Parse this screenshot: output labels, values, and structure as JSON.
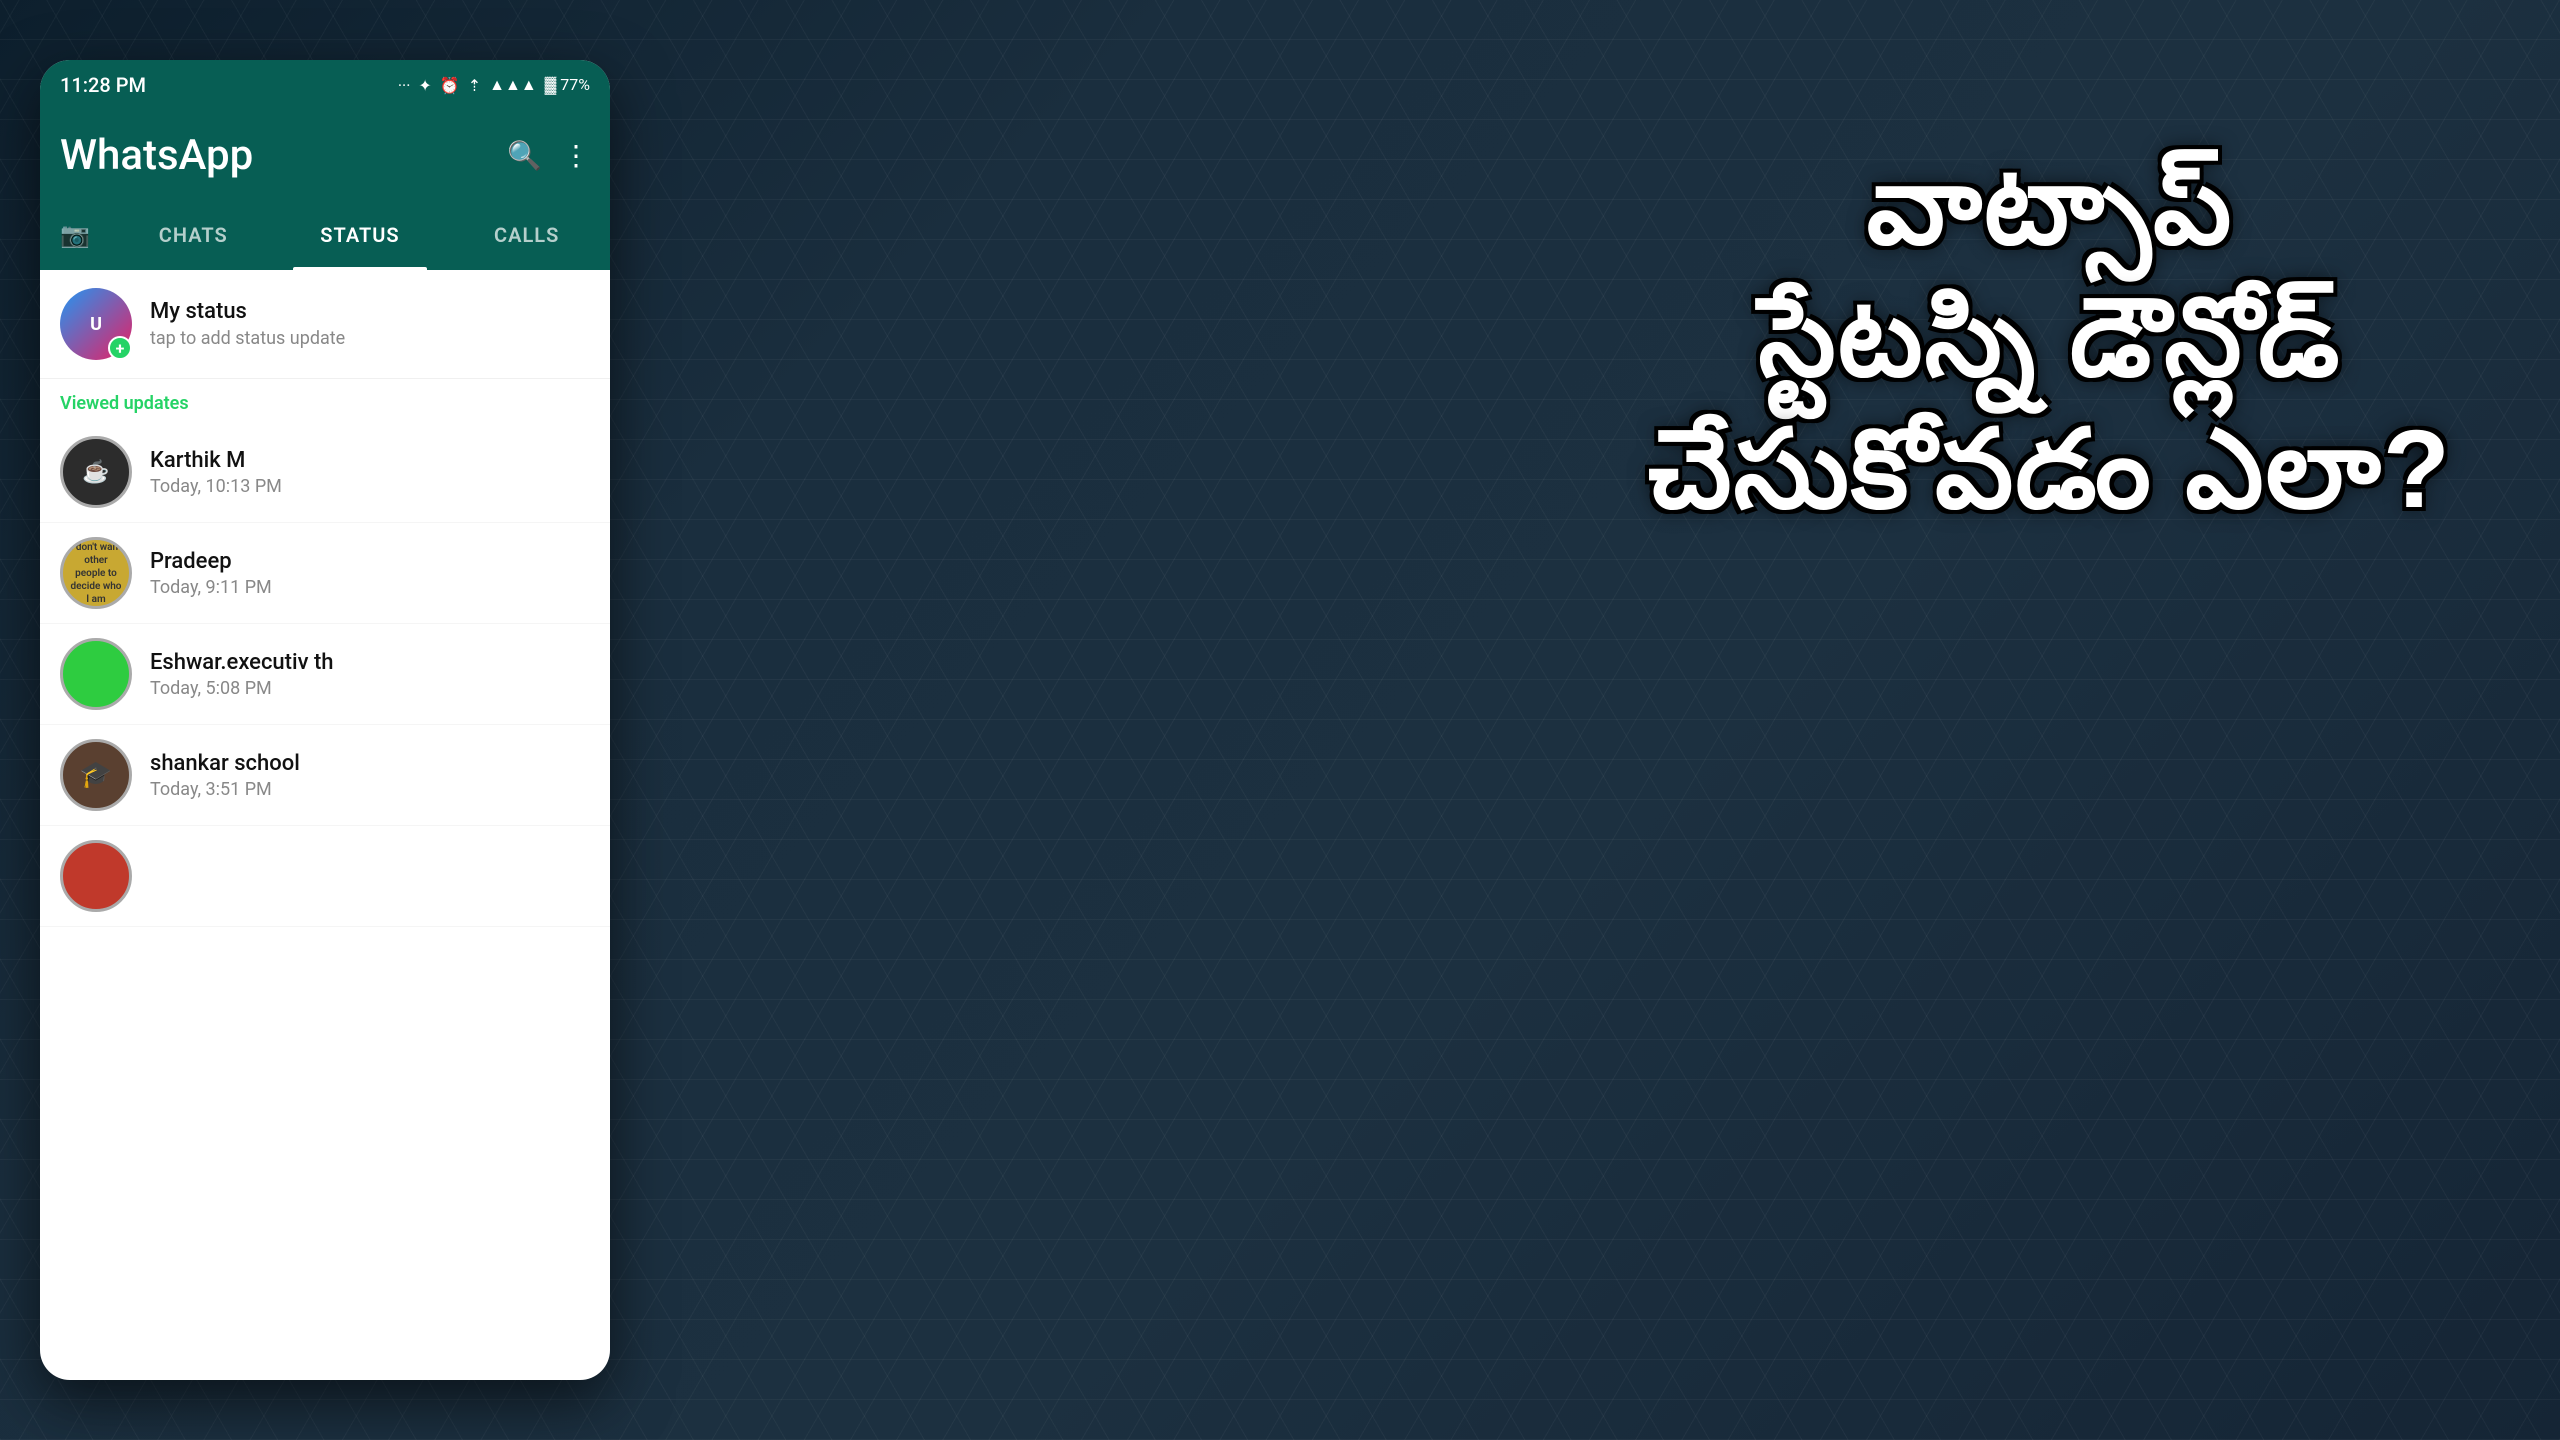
{
  "background": {
    "color": "#1a2a3a"
  },
  "telugu": {
    "line1": "వాట్సాప్",
    "line2": "స్టేటస్ని డౌన్లోడ్",
    "line3": "చేసుకోవడం ఎలా?"
  },
  "phone": {
    "status_bar": {
      "time": "11:28 PM",
      "icons": "... ✦ ⏰ ☁ ▲▲▲ 🔋 77%"
    },
    "header": {
      "title": "WhatsApp",
      "search_icon": "🔍",
      "menu_icon": "⋮"
    },
    "tabs": {
      "camera_label": "📷",
      "items": [
        {
          "label": "CHATS",
          "active": false
        },
        {
          "label": "STATUS",
          "active": true
        },
        {
          "label": "CALLS",
          "active": false
        }
      ]
    },
    "my_status": {
      "name": "My status",
      "sub": "tap to add status update"
    },
    "viewed_section": {
      "label": "Viewed updates"
    },
    "contacts": [
      {
        "name": "Karthik M",
        "time": "Today, 10:13 PM",
        "avatar_type": "dark",
        "avatar_text": "☕"
      },
      {
        "name": "Pradeep",
        "time": "Today, 9:11 PM",
        "avatar_type": "gold",
        "avatar_text": "I don't want other people to decide who I am. I want to decide that for myself"
      },
      {
        "name": "Eshwar.executiv th",
        "time": "Today, 5:08 PM",
        "avatar_type": "green",
        "avatar_text": ""
      },
      {
        "name": "shankar school",
        "time": "Today, 3:51 PM",
        "avatar_type": "brown",
        "avatar_text": "🎓"
      }
    ]
  }
}
